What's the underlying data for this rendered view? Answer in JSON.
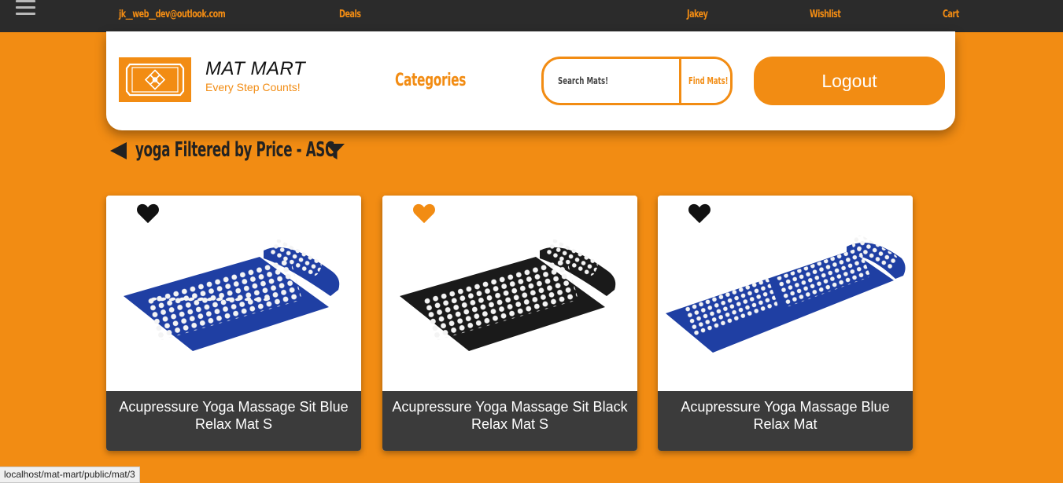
{
  "topbar": {
    "email": "jk__web__dev@outlook.com",
    "deals": "Deals",
    "user": "Jakey",
    "wishlist": "Wishlist",
    "cart": "Cart"
  },
  "header": {
    "brand_name": "MAT MART",
    "tagline": "Every Step Counts!",
    "categories": "Categories",
    "search_placeholder": "Search Mats!",
    "search_button": "Find Mats!",
    "logout": "Logout"
  },
  "filter": {
    "title": "yoga Filtered by Price - ASC"
  },
  "products": [
    {
      "name": "Acupressure Yoga Massage Sit Blue Relax Mat S",
      "wishlisted": false,
      "mat_color": "#1f3fa3"
    },
    {
      "name": "Acupressure Yoga Massage Sit Black Relax Mat S",
      "wishlisted": true,
      "mat_color": "#1a1a1a"
    },
    {
      "name": "Acupressure Yoga Massage Blue Relax Mat",
      "wishlisted": false,
      "mat_color": "#1f3fa3"
    }
  ],
  "status_bar": {
    "url": "localhost/mat-mart/public/mat/3"
  },
  "colors": {
    "accent": "#f28c13",
    "topbar": "#2b2b2b",
    "caption": "#3b3b3b",
    "heart_default": "#111111",
    "heart_active": "#f28c13"
  }
}
